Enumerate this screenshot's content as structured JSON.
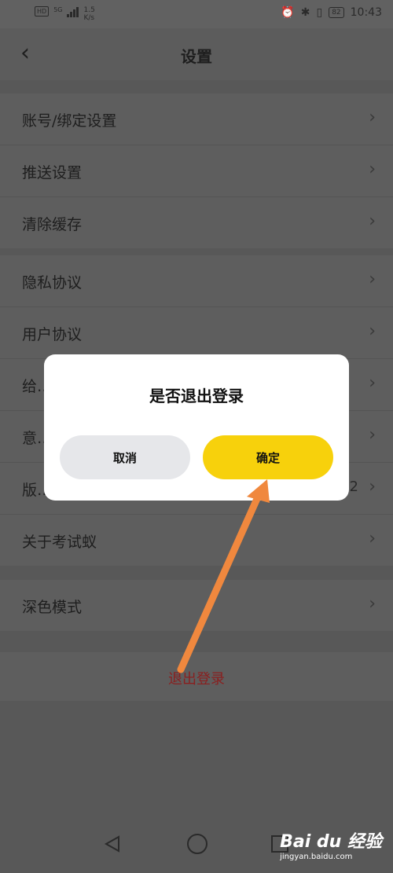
{
  "status_bar": {
    "hd": "HD",
    "network": "5G",
    "speed_value": "1.5",
    "speed_unit": "K/s",
    "battery": "82",
    "time": "10:43"
  },
  "header": {
    "back_icon": "chevron-left-icon",
    "title": "设置"
  },
  "groups": [
    {
      "items": [
        {
          "label": "账号/绑定设置"
        },
        {
          "label": "推送设置"
        },
        {
          "label": "清除缓存"
        }
      ]
    },
    {
      "items": [
        {
          "label": "隐私协议"
        },
        {
          "label": "用户协议"
        },
        {
          "label": "给…"
        },
        {
          "label": "意…"
        },
        {
          "label": "版…",
          "value": "2"
        },
        {
          "label": "关于考试蚁"
        }
      ]
    },
    {
      "items": [
        {
          "label": "深色模式"
        }
      ]
    }
  ],
  "logout_label": "退出登录",
  "dialog": {
    "title": "是否退出登录",
    "cancel_label": "取消",
    "confirm_label": "确定"
  },
  "annotation": {
    "icon": "orange-arrow-icon",
    "color": "#f0883e"
  },
  "nav": {
    "back_icon": "nav-back-icon",
    "home_icon": "nav-home-icon",
    "recent_icon": "nav-recent-icon"
  },
  "watermark": {
    "logo": "Bai du 经验",
    "url": "jingyan.baidu.com"
  },
  "colors": {
    "accent": "#f7d10c",
    "logout": "#8a1f1f"
  }
}
